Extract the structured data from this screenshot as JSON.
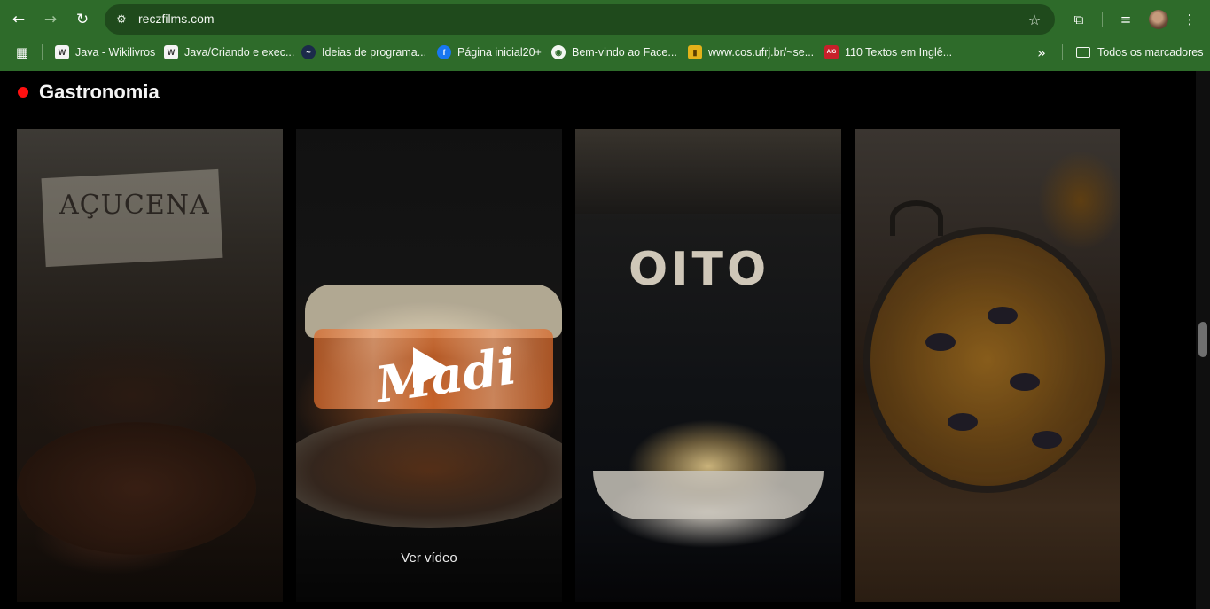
{
  "browser": {
    "url": "reczfilms.com",
    "icons": {
      "back": "arrow-left-icon",
      "forward": "arrow-right-icon",
      "reload": "reload-icon",
      "site_info": "tune-icon",
      "bookmark_star": "star-icon",
      "extensions": "puzzle-icon",
      "media": "playlist-icon",
      "menu": "kebab-menu-icon",
      "apps": "grid-icon"
    },
    "theme_color": "#2e6b2a",
    "bookmarks": [
      {
        "label": "Java - Wikilivros",
        "icon": "W"
      },
      {
        "label": "Java/Criando e exec...",
        "icon": "W"
      },
      {
        "label": "Ideias de programa...",
        "icon": "~"
      },
      {
        "label": "Página inicial20+",
        "icon": "f"
      },
      {
        "label": "Bem-vindo ao Face...",
        "icon": "◉"
      },
      {
        "label": "www.cos.ufrj.br/~se...",
        "icon": "▮"
      },
      {
        "label": "110 Textos em Inglê...",
        "icon": "AIG"
      }
    ],
    "all_bookmarks_label": "Todos os marcadores"
  },
  "page": {
    "section_title": "Gastronomia",
    "accent_color": "#ff1010",
    "cards": [
      {
        "photo_text": "AÇUCENA"
      },
      {
        "logo_text": "Madi",
        "cta": "Ver vídeo"
      },
      {
        "photo_text": "OITO"
      },
      {}
    ]
  }
}
